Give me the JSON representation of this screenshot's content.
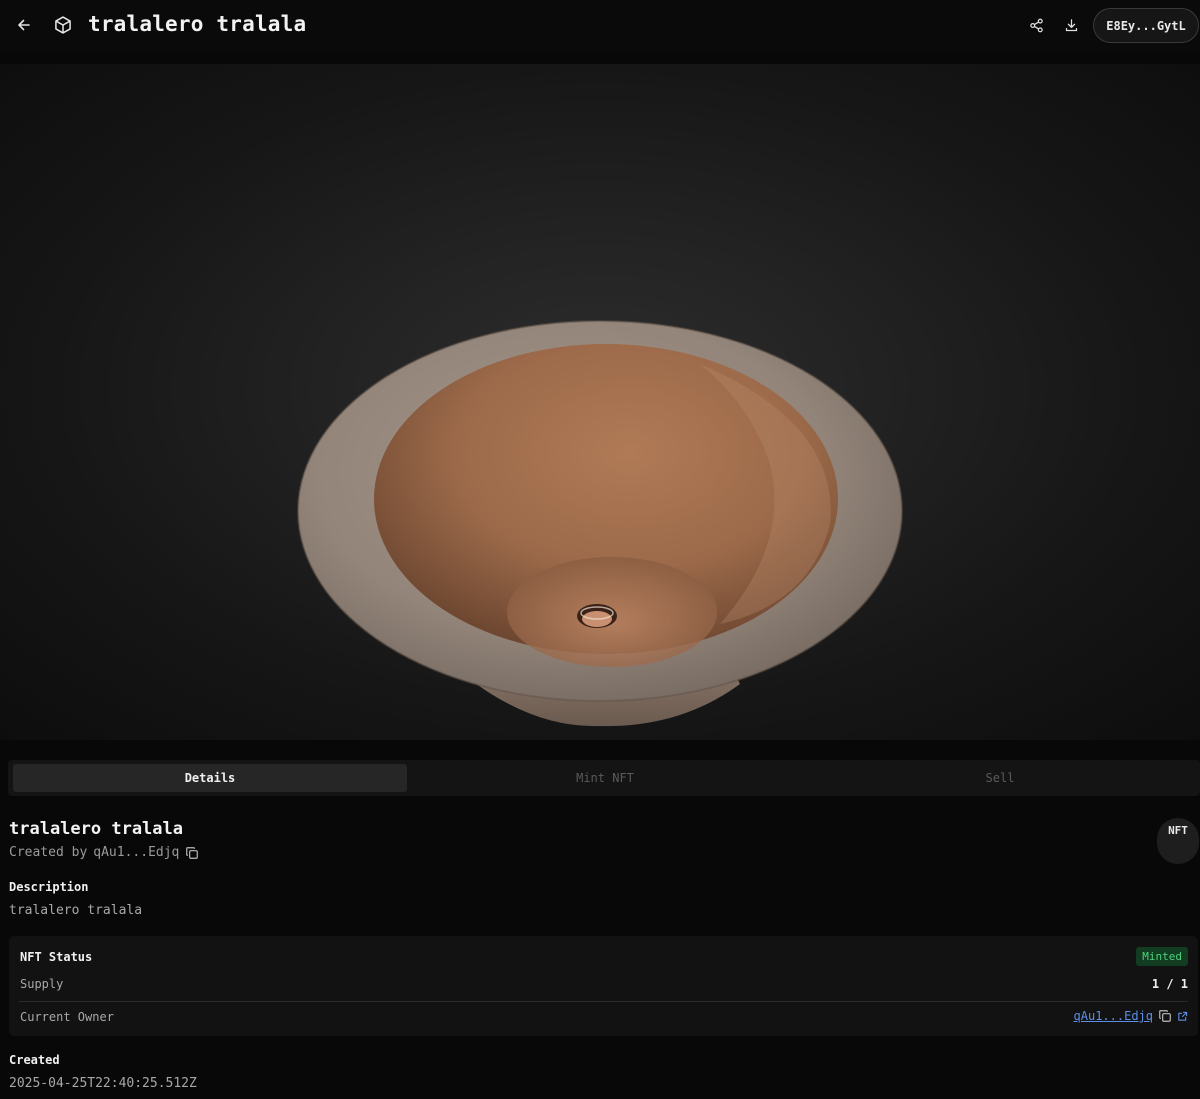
{
  "header": {
    "title": "tralalero tralala",
    "back_icon": "arrow-left-icon",
    "model_icon": "cube-icon",
    "share_icon": "share-icon",
    "download_icon": "download-icon",
    "wallet_label": "E8Ey...GytL"
  },
  "tabs": [
    {
      "label": "Details",
      "active": true
    },
    {
      "label": "Mint NFT",
      "active": false
    },
    {
      "label": "Sell",
      "active": false
    }
  ],
  "details": {
    "title": "tralalero tralala",
    "created_by_prefix": "Created by",
    "creator": "qAu1...Edjq",
    "badge": "NFT",
    "description_label": "Description",
    "description": "tralalero tralala",
    "status": {
      "title": "NFT Status",
      "badge": "Minted",
      "badge_color": "#4ed17d",
      "supply_label": "Supply",
      "supply_value": "1 / 1",
      "owner_label": "Current Owner",
      "owner_value": "qAu1...Edjq"
    },
    "created_label": "Created",
    "created_value": "2025-04-25T22:40:25.512Z"
  },
  "colors": {
    "background": "#080808",
    "link": "#5c8fe6",
    "bowl_inner": "#a06a4a",
    "bowl_rim": "#9a8a7e"
  }
}
